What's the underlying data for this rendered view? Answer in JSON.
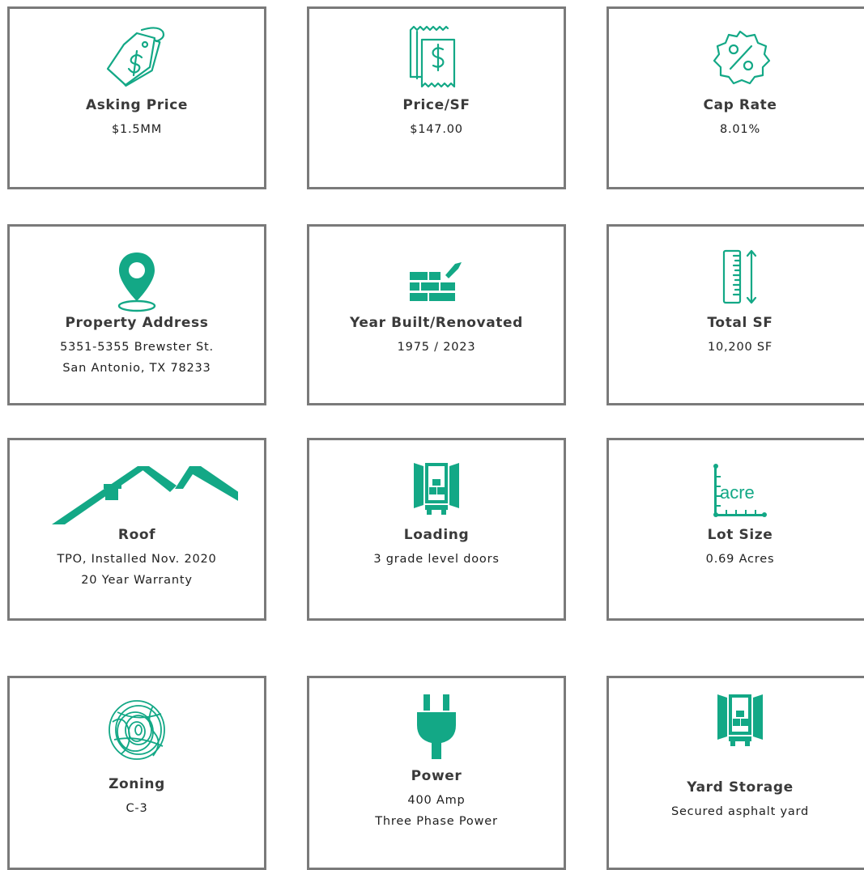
{
  "colors": {
    "accent": "#13a886",
    "border": "#7a7a7a"
  },
  "cards": [
    {
      "icon": "price-tag-icon",
      "title": "Asking Price",
      "lines": [
        "$1.5MM"
      ]
    },
    {
      "icon": "receipt-icon",
      "title": "Price/SF",
      "lines": [
        "$147.00"
      ]
    },
    {
      "icon": "percent-badge-icon",
      "title": "Cap Rate",
      "lines": [
        "8.01%"
      ]
    },
    {
      "icon": "map-pin-icon",
      "title": "Property Address",
      "lines": [
        "5351-5355 Brewster St.",
        "San Antonio, TX 78233"
      ]
    },
    {
      "icon": "bricks-trowel-icon",
      "title": "Year Built/Renovated",
      "lines": [
        "1975 / 2023"
      ]
    },
    {
      "icon": "ruler-icon",
      "title": "Total SF",
      "lines": [
        "10,200 SF"
      ]
    },
    {
      "icon": "roof-icon",
      "title": "Roof",
      "lines": [
        "TPO, Installed Nov. 2020",
        "20 Year Warranty"
      ]
    },
    {
      "icon": "loading-truck-icon",
      "title": "Loading",
      "lines": [
        "3 grade level doors"
      ]
    },
    {
      "icon": "acre-ruler-icon",
      "title": "Lot Size",
      "lines": [
        "0.69 Acres"
      ],
      "icon_text": "acre"
    },
    {
      "icon": "fingerprint-icon",
      "title": "Zoning",
      "lines": [
        "C-3"
      ]
    },
    {
      "icon": "power-plug-icon",
      "title": "Power",
      "lines": [
        "400 Amp",
        "Three Phase Power"
      ]
    },
    {
      "icon": "storage-truck-icon",
      "title": "Yard Storage",
      "lines": [
        "Secured asphalt yard"
      ]
    }
  ]
}
